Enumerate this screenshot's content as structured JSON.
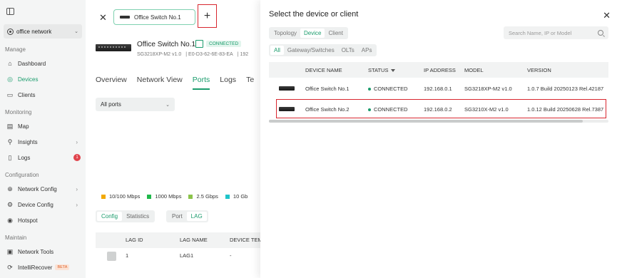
{
  "sidebar": {
    "site": "office network",
    "sections": {
      "manage": "Manage",
      "monitoring": "Monitoring",
      "configuration": "Configuration",
      "maintain": "Maintain"
    },
    "items": {
      "dashboard": "Dashboard",
      "devices": "Devices",
      "clients": "Clients",
      "map": "Map",
      "insights": "Insights",
      "logs": "Logs",
      "logs_badge": "1",
      "network_config": "Network Config",
      "device_config": "Device Config",
      "hotspot": "Hotspot",
      "network_tools": "Network Tools",
      "intellirecover": "IntelliRecover",
      "beta": "BETA"
    }
  },
  "main": {
    "tab_label": "Office Switch No.1",
    "device": {
      "name": "Office Switch No.1",
      "status": "CONNECTED",
      "model": "SG3218XP-M2 v1.0",
      "mac": "E0-D3-62-6E-83-EA",
      "ip_partial": "192"
    },
    "tabs": [
      "Overview",
      "Network View",
      "Ports",
      "Logs",
      "Te"
    ],
    "ports_filter": "All ports",
    "legend": [
      {
        "label": "10/100 Mbps",
        "color": "#f2a900"
      },
      {
        "label": "1000 Mbps",
        "color": "#1fb84a"
      },
      {
        "label": "2.5 Gbps",
        "color": "#8bc34a"
      },
      {
        "label": "10 Gb",
        "color": "#1fc4c9"
      }
    ],
    "subtabs_left": [
      "Config",
      "Statistics"
    ],
    "subtabs_right": [
      "Port",
      "LAG"
    ],
    "table": {
      "headers": [
        "LAG ID",
        "LAG NAME",
        "DEVICE TEM"
      ],
      "rows": [
        [
          "1",
          "LAG1",
          "-"
        ]
      ]
    }
  },
  "dialog": {
    "title": "Select the device or client",
    "type_tabs": [
      "Topology",
      "Device",
      "Client"
    ],
    "filter_tabs": [
      "All",
      "Gateway/Switches",
      "OLTs",
      "APs"
    ],
    "search_placeholder": "Search Name, IP or Model",
    "headers": [
      "DEVICE NAME",
      "STATUS",
      "IP ADDRESS",
      "MODEL",
      "VERSION"
    ],
    "rows": [
      {
        "name": "Office Switch No.1",
        "status": "CONNECTED",
        "ip": "192.168.0.1",
        "model": "SG3218XP-M2 v1.0",
        "version": "1.0.7 Build 20250123 Rel.42187"
      },
      {
        "name": "Office Switch No.2",
        "status": "CONNECTED",
        "ip": "192.168.0.2",
        "model": "SG3210X-M2 v1.0",
        "version": "1.0.12 Build 20250628 Rel.7387"
      }
    ]
  },
  "colors": {
    "accent": "#1a9c6c",
    "highlight": "#d8262f",
    "badge": "#e0434c"
  }
}
